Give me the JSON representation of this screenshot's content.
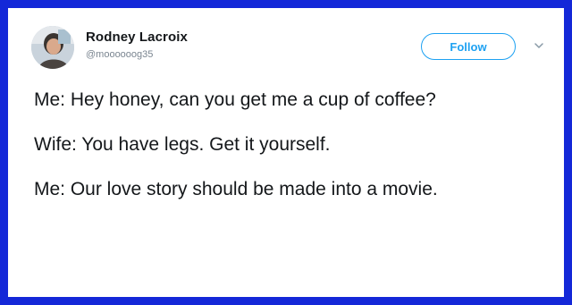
{
  "tweet": {
    "author": {
      "display_name": "Rodney Lacroix",
      "handle": "@moooooog35"
    },
    "follow_label": "Follow",
    "menu_icon": "chevron-down-icon",
    "paragraphs": [
      "Me: Hey honey, can you get me a cup of coffee?",
      "Wife: You have legs. Get it yourself.",
      "Me: Our love story should be made into a movie."
    ]
  },
  "colors": {
    "border": "#1428d8",
    "accent": "#1da1f2",
    "text": "#14171a",
    "muted": "#7a8590"
  }
}
